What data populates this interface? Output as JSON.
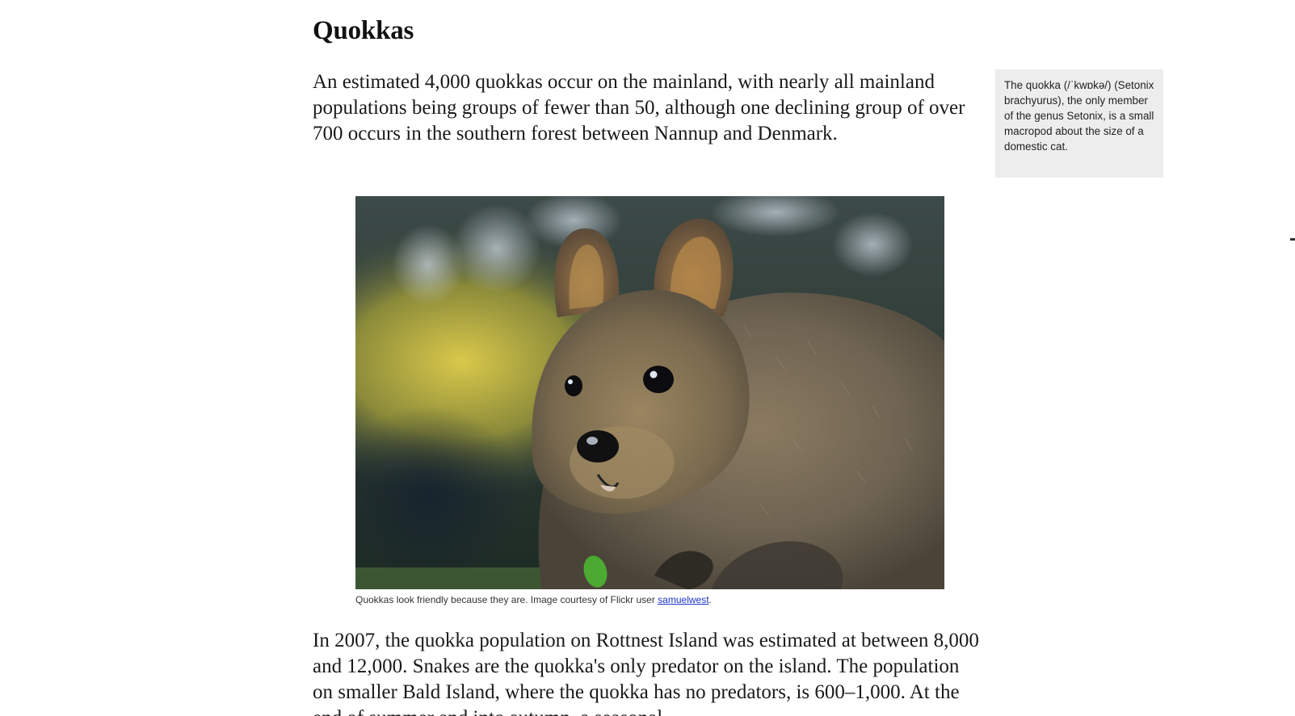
{
  "article": {
    "title": "Quokkas",
    "paragraph_1": "An estimated 4,000 quokkas occur on the mainland, with nearly all mainland populations being groups of fewer than 50, although one declining group of over 700 occurs in the southern forest between Nannup and Denmark.",
    "paragraph_2": "In 2007, the quokka population on Rottnest Island was estimated at between 8,000 and 12,000. Snakes are the quokka's only predator on the island. The population on smaller Bald Island, where the quokka has no predators, is 600–1,000. At the end of summer and into autumn, a seasonal"
  },
  "aside": {
    "text": "The quokka (/ˈkwɒkə/) (Setonix brachyurus), the only member of the genus Setonix, is a small macropod about the size of a domestic cat."
  },
  "figure": {
    "image_subject": "quokka-photo",
    "caption_text": "Quokkas look friendly because they are. Image courtesy of Flickr user ",
    "caption_link": "samuelwest",
    "caption_end": "."
  },
  "colors": {
    "aside_background": "#ededed",
    "link": "#1a35c8",
    "text": "#1a1a1a"
  }
}
